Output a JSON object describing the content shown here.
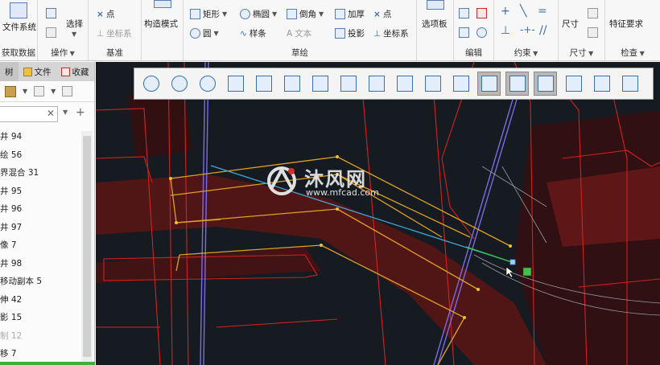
{
  "ribbon": {
    "groups": {
      "get_data": {
        "label": "获取数据",
        "file_system": "文件系统"
      },
      "operations": {
        "label": "操作",
        "select": "选择"
      },
      "datum": {
        "label": "基准",
        "point": "点",
        "csys": "坐标系"
      },
      "construction": {
        "label": "构造模式"
      },
      "sketch": {
        "label": "草绘",
        "rectangle": "矩形",
        "ellipse": "椭圆",
        "chamfer": "倒角",
        "thicken": "加厚",
        "point": "点",
        "circle": "圆",
        "spline": "样条",
        "text": "文本",
        "project": "投影",
        "csys": "坐标系"
      },
      "palette": {
        "label": "选项板"
      },
      "edit": {
        "label": "编辑"
      },
      "constrain": {
        "label": "约束"
      },
      "dimension": {
        "label": "尺寸",
        "button": "尺寸"
      },
      "inspect": {
        "label": "检查",
        "feature_req": "特征要求"
      }
    }
  },
  "left_panel": {
    "tabs": [
      "树",
      "文件",
      "收藏"
    ],
    "search_placeholder": "",
    "tree_items": [
      {
        "label": "井 94",
        "dim": false
      },
      {
        "label": "绘 56",
        "dim": false
      },
      {
        "label": "界混合 31",
        "dim": false
      },
      {
        "label": "井 95",
        "dim": false
      },
      {
        "label": "井 96",
        "dim": false
      },
      {
        "label": "井 97",
        "dim": false
      },
      {
        "label": "像 7",
        "dim": false
      },
      {
        "label": "井 98",
        "dim": false
      },
      {
        "label": "移动副本 5",
        "dim": false
      },
      {
        "label": "伸 42",
        "dim": false
      },
      {
        "label": "影 15",
        "dim": false
      },
      {
        "label": "制 12",
        "dim": true
      },
      {
        "label": "移 7",
        "dim": false
      }
    ]
  },
  "graphics_toolbar": {
    "buttons": [
      "refit-icon",
      "zoom-in-icon",
      "zoom-out-icon",
      "repaint-icon",
      "orientation-icon",
      "saved-views-icon",
      "view-manager-icon",
      "sketch-view-icon",
      "datum-display-icon",
      "spin-center-icon",
      "display-style-icon",
      "annotation-display-icon",
      "sketch-display-icon",
      "csys-display-icon",
      "visibility-icon",
      "appearance-icon",
      "section-icon",
      "perspective-icon"
    ]
  },
  "watermark": {
    "title": "沐风网",
    "url": "www.mfcad.com"
  },
  "colors": {
    "canvas_bg": "#151b20",
    "model_edge": "#d62020",
    "sketch_line": "#e0a020",
    "construction": "#7b6ae6",
    "selection": "#40a8e0",
    "accent_green": "#40c040"
  }
}
